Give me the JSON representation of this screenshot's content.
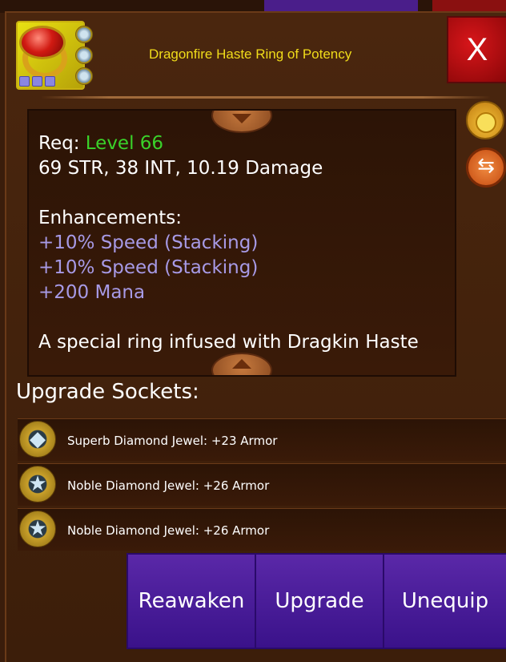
{
  "item": {
    "name": "Dragonfire Haste Ring of Potency",
    "icon": "ruby-ring-icon",
    "socket_pips": 3,
    "colors": {
      "title": "#f0dc1a",
      "level": "#3ad22a",
      "enhancement": "#a79ae6"
    }
  },
  "close_label": "X",
  "description": {
    "req_prefix": "Req:",
    "req_level": "Level 66",
    "stats": "69 STR, 38 INT, 10.19 Damage",
    "enhancements_header": "Enhancements:",
    "enhancements": [
      "+10% Speed (Stacking)",
      "+10% Speed (Stacking)",
      "+200 Mana"
    ],
    "flavor_text": "A special ring infused with Dragkin Haste"
  },
  "side_buttons": {
    "top": "coin-bag-icon",
    "bottom": "swap-arrows-icon"
  },
  "sockets": {
    "title": "Upgrade Sockets:",
    "items": [
      {
        "label": "Superb Diamond Jewel: +23 Armor",
        "icon": "diamond-jewel-icon"
      },
      {
        "label": "Noble Diamond Jewel: +26 Armor",
        "icon": "star-jewel-icon"
      },
      {
        "label": "Noble Diamond Jewel: +26 Armor",
        "icon": "star-jewel-icon"
      }
    ]
  },
  "actions": {
    "reawaken": "Reawaken",
    "upgrade": "Upgrade",
    "unequip": "Unequip"
  }
}
